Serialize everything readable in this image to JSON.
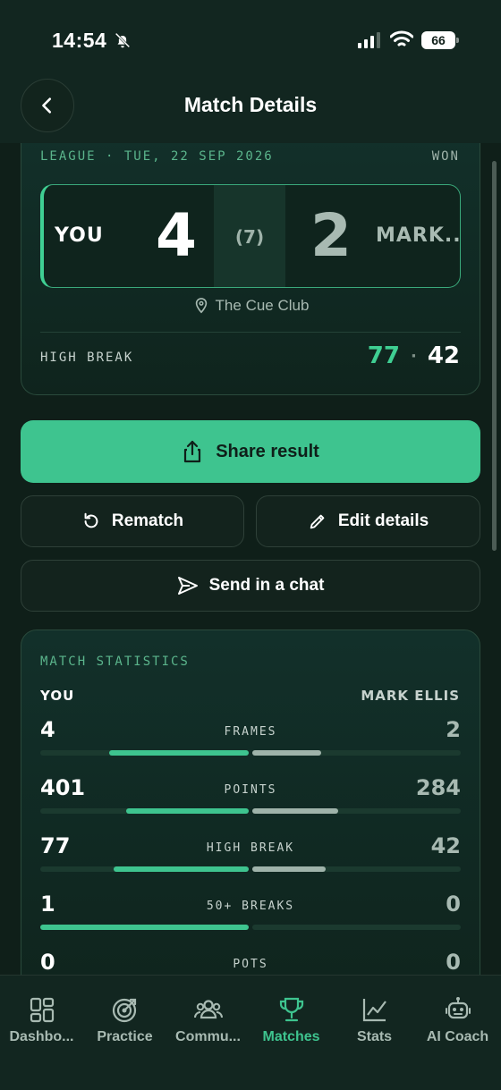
{
  "status": {
    "time": "14:54",
    "battery": "66"
  },
  "header": {
    "title": "Match Details"
  },
  "match": {
    "meta_left": "LEAGUE · TUE, 22 SEP 2026",
    "result": "WON",
    "you_name": "YOU",
    "you_score": "4",
    "frames_total": "(7)",
    "opp_score": "2",
    "opp_name": "MARK...",
    "venue": "The Cue Club",
    "high_break_label": "HIGH BREAK",
    "high_break_you": "77",
    "high_break_sep": "·",
    "high_break_opp": "42"
  },
  "actions": {
    "share": "Share result",
    "rematch": "Rematch",
    "edit": "Edit details",
    "send": "Send in a chat"
  },
  "stats": {
    "title": "MATCH STATISTICS",
    "you_header": "YOU",
    "opp_header": "MARK ELLIS",
    "rows": [
      {
        "label": "FRAMES",
        "you": "4",
        "opp": "2",
        "you_share": 0.67,
        "opp_share": 0.33
      },
      {
        "label": "POINTS",
        "you": "401",
        "opp": "284",
        "you_share": 0.59,
        "opp_share": 0.41
      },
      {
        "label": "HIGH BREAK",
        "you": "77",
        "opp": "42",
        "you_share": 0.65,
        "opp_share": 0.35
      },
      {
        "label": "50+ BREAKS",
        "you": "1",
        "opp": "0",
        "you_share": 1.0,
        "opp_share": 0.0
      },
      {
        "label": "POTS",
        "you": "0",
        "opp": "0",
        "you_share": 0.0,
        "opp_share": 0.0
      }
    ]
  },
  "tabs": [
    {
      "label": "Dashbo...",
      "icon": "dashboard-icon",
      "active": false
    },
    {
      "label": "Practice",
      "icon": "target-icon",
      "active": false
    },
    {
      "label": "Commu...",
      "icon": "community-icon",
      "active": false
    },
    {
      "label": "Matches",
      "icon": "trophy-icon",
      "active": true
    },
    {
      "label": "Stats",
      "icon": "stats-chart-icon",
      "active": false
    },
    {
      "label": "AI Coach",
      "icon": "robot-icon",
      "active": false
    }
  ],
  "colors": {
    "accent": "#3ec48f",
    "background": "#0f1f19",
    "muted": "#a8bab2"
  }
}
